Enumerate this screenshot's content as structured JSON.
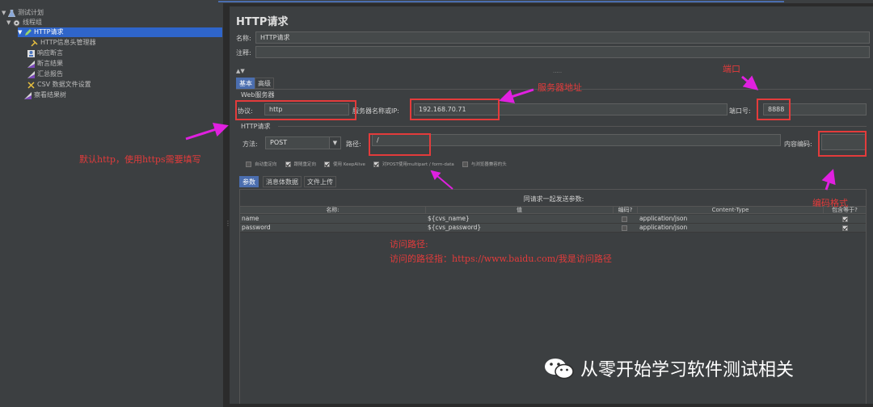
{
  "tree": {
    "items": [
      {
        "label": "测试计划"
      },
      {
        "label": "线程组"
      },
      {
        "label": "HTTP请求"
      },
      {
        "label": "HTTP信息头管理器"
      },
      {
        "label": "响应断言"
      },
      {
        "label": "断言结果"
      },
      {
        "label": "汇总报告"
      },
      {
        "label": "CSV 数据文件设置"
      },
      {
        "label": "察看结果树"
      }
    ]
  },
  "main": {
    "title": "HTTP请求",
    "name_label": "名称:",
    "name_value": "HTTP请求",
    "comment_label": "注释:",
    "tabs": [
      "基本",
      "高级"
    ],
    "web_server_title": "Web服务器",
    "protocol_label": "协议:",
    "protocol_value": "http",
    "server_label": "服务器名称或IP:",
    "server_value": "192.168.70.71",
    "port_label": "端口号:",
    "port_value": "8888",
    "http_request_title": "HTTP请求",
    "method_label": "方法:",
    "method_value": "POST",
    "path_label": "路径:",
    "path_value": "/",
    "encoding_label": "内容编码:",
    "encoding_value": "",
    "checkboxes": [
      {
        "label": "自动重定向",
        "checked": false
      },
      {
        "label": "跟随重定向",
        "checked": true
      },
      {
        "label": "使用 KeepAlive",
        "checked": true
      },
      {
        "label": "对POST使用multipart / form-data",
        "checked": true
      },
      {
        "label": "与浏览器兼容的头",
        "checked": false
      }
    ],
    "param_tabs": [
      "参数",
      "消息体数据",
      "文件上传"
    ],
    "table": {
      "caption": "同请求一起发送参数:",
      "headers": [
        "名称:",
        "值",
        "编码?",
        "Content-Type",
        "包含等于?"
      ],
      "rows": [
        {
          "name": "name",
          "value": "${cvs_name}",
          "encode": false,
          "content_type": "application/json",
          "include_equals": true
        },
        {
          "name": "password",
          "value": "${cvs_password}",
          "encode": false,
          "content_type": "application/json",
          "include_equals": true
        }
      ]
    }
  },
  "annotations": {
    "default_http": "默认http，使用https需要填写",
    "server_address": "服务器地址",
    "port": "端口",
    "encoding_format": "编码格式",
    "access_path_title": "访问路径:",
    "access_path_desc": "访问的路径指：https://www.baidu.com/我是访问路径"
  },
  "watermark": {
    "text": "从零开始学习软件测试相关",
    "icon": "wechat-icon"
  },
  "colors": {
    "annotation_red": "#e33b3b",
    "arrow_magenta": "#e020e0",
    "selection_blue": "#2f65ca",
    "tab_active": "#4b6eaf"
  }
}
